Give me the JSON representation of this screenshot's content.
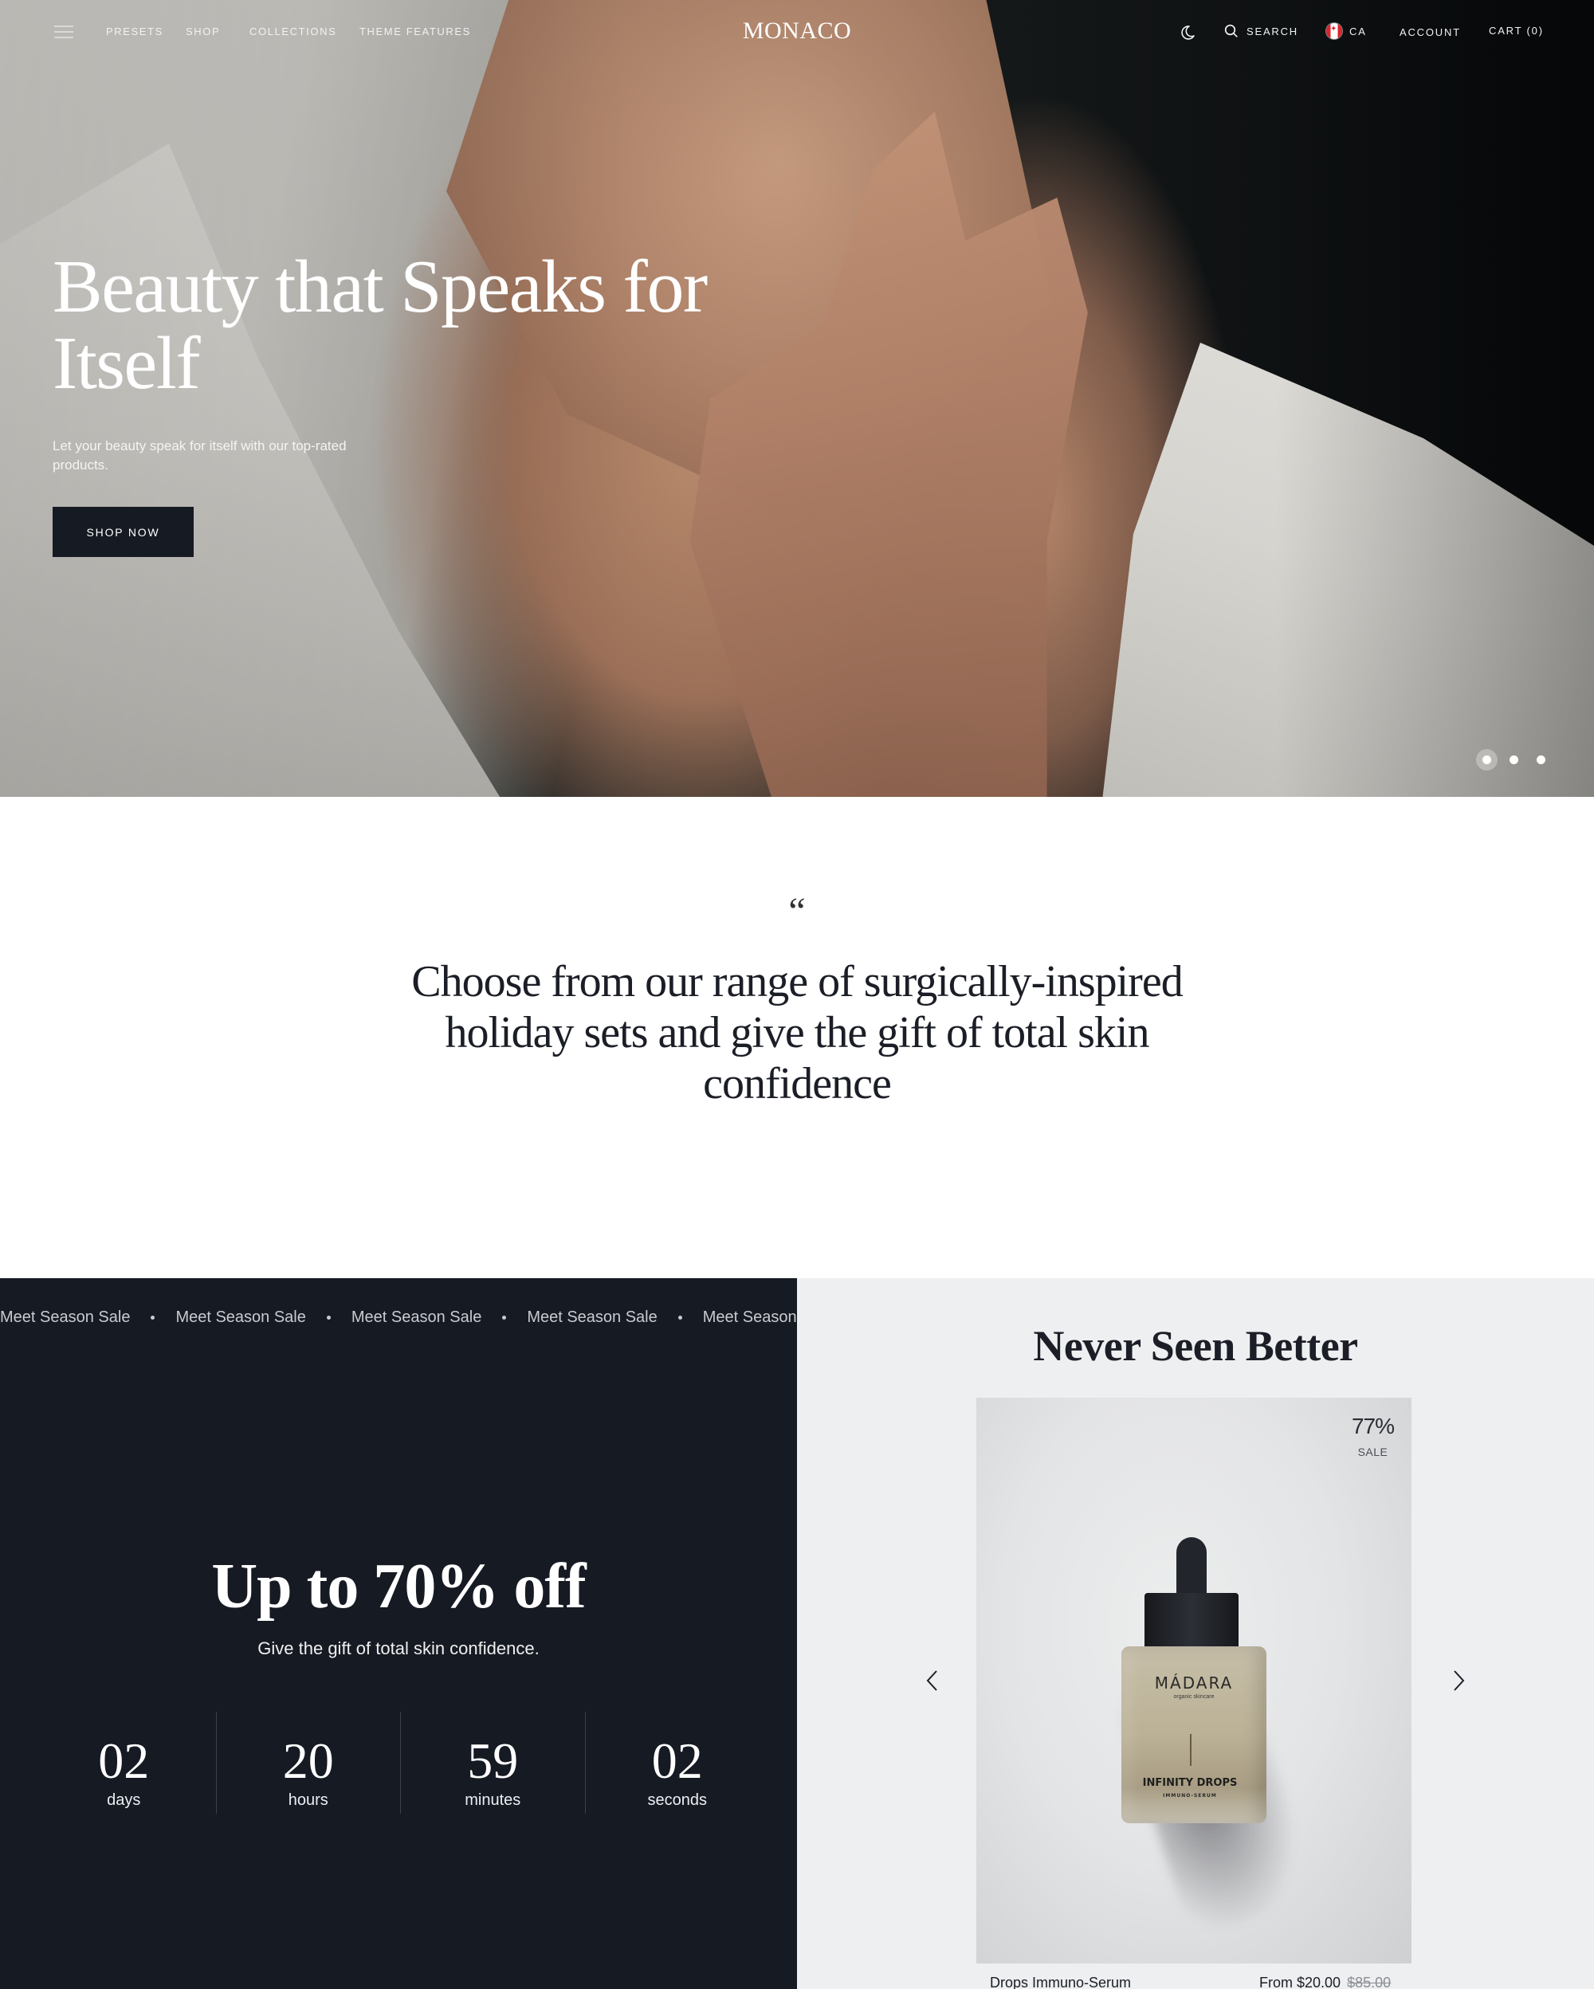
{
  "header": {
    "logo": "MONACO",
    "nav": [
      {
        "label": "PRESETS"
      },
      {
        "label": "SHOP"
      },
      {
        "label": "COLLECTIONS"
      },
      {
        "label": "THEME FEATURES"
      }
    ],
    "search_label": "SEARCH",
    "country_code": "CA",
    "account_label": "ACCOUNT",
    "cart_label": "CART (0)",
    "icons": {
      "menu": "hamburger-menu-icon",
      "theme_toggle": "moon-icon",
      "search": "search-icon",
      "flag": "canada-flag-icon"
    }
  },
  "hero": {
    "title": "Beauty that Speaks for Itself",
    "subtitle": "Let your beauty speak for itself with our top-rated products.",
    "cta_label": "SHOP NOW",
    "slides_total": 3,
    "active_slide": 1
  },
  "quote": {
    "mark": "“",
    "text": "Choose from our range of surgically-inspired holiday sets and give the gift of total skin confidence"
  },
  "sale": {
    "marquee_items": [
      "Meet Season Sale",
      "Meet Season Sale",
      "Meet Season Sale",
      "Meet Season Sale",
      "Meet Season"
    ],
    "title": "Up to 70% off",
    "subtitle": "Give the gift of total skin confidence.",
    "countdown": [
      {
        "value": "02",
        "label": "days"
      },
      {
        "value": "20",
        "label": "hours"
      },
      {
        "value": "59",
        "label": "minutes"
      },
      {
        "value": "02",
        "label": "seconds"
      }
    ]
  },
  "featured": {
    "heading": "Never Seen Better",
    "product": {
      "name": "Drops Immuno-Serum",
      "price": "From $20.00",
      "compare_price": "$85.00",
      "badge_percent": "77%",
      "badge_label": "SALE",
      "image_brand": "MÁDARA",
      "image_tagline": "organic skincare",
      "image_product": "INFINITY DROPS",
      "image_subproduct": "IMMUNO-SERUM"
    },
    "icons": {
      "prev": "chevron-left-icon",
      "next": "chevron-right-icon"
    }
  },
  "colors": {
    "dark_navy": "#161a23",
    "light_panel": "#eeeff1",
    "text_dark": "#1b1e26",
    "white": "#ffffff"
  }
}
